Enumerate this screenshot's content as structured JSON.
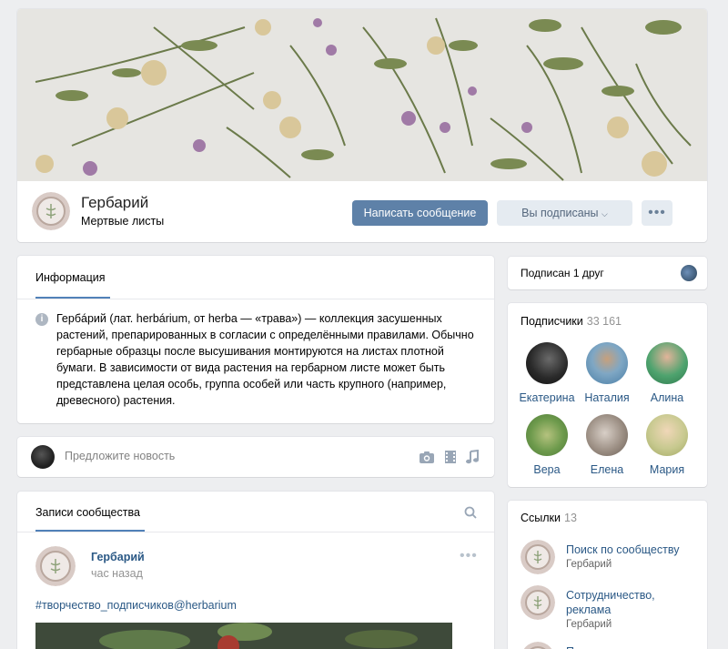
{
  "group": {
    "name": "Гербарий",
    "status": "Мертвые листы",
    "btn_message": "Написать сообщение",
    "btn_subscribed": "Вы подписаны",
    "btn_more": "•••"
  },
  "info": {
    "tab": "Информация",
    "text": "Гербáрий (лат. herbárium, от herba — «трава») — коллекция засушенных растений, препарированных в согласии с определёнными правилами. Обычно гербарные образцы после высушивания монтируются на листах плотной бумаги. В зависимости от вида растения на гербарном листе может быть представлена целая особь, группа особей или часть крупного (например, древесного) растения."
  },
  "suggest": {
    "placeholder": "Предложите новость",
    "icons": [
      "camera-icon",
      "video-icon",
      "music-icon"
    ]
  },
  "wall": {
    "tab": "Записи сообщества",
    "post": {
      "author": "Гербарий",
      "time": "час назад",
      "more": "•••",
      "tag": "#творчество_подписчиков@herbarium"
    }
  },
  "friends": {
    "text": "Подписан 1 друг"
  },
  "followers": {
    "title": "Подписчики",
    "count": "33 161",
    "items": [
      {
        "name": "Екатерина"
      },
      {
        "name": "Наталия"
      },
      {
        "name": "Алина"
      },
      {
        "name": "Вера"
      },
      {
        "name": "Елена"
      },
      {
        "name": "Мария"
      }
    ]
  },
  "links": {
    "title": "Ссылки",
    "count": "13",
    "items": [
      {
        "title": "Поиск по сообществу",
        "sub": "Гербарий"
      },
      {
        "title": "Сотрудничество, реклама",
        "sub": "Гербарий"
      },
      {
        "title": "П",
        "sub": ""
      }
    ]
  },
  "colors": {
    "accent": "#5e81a8",
    "link": "#2a5885",
    "background": "#edeef0"
  }
}
